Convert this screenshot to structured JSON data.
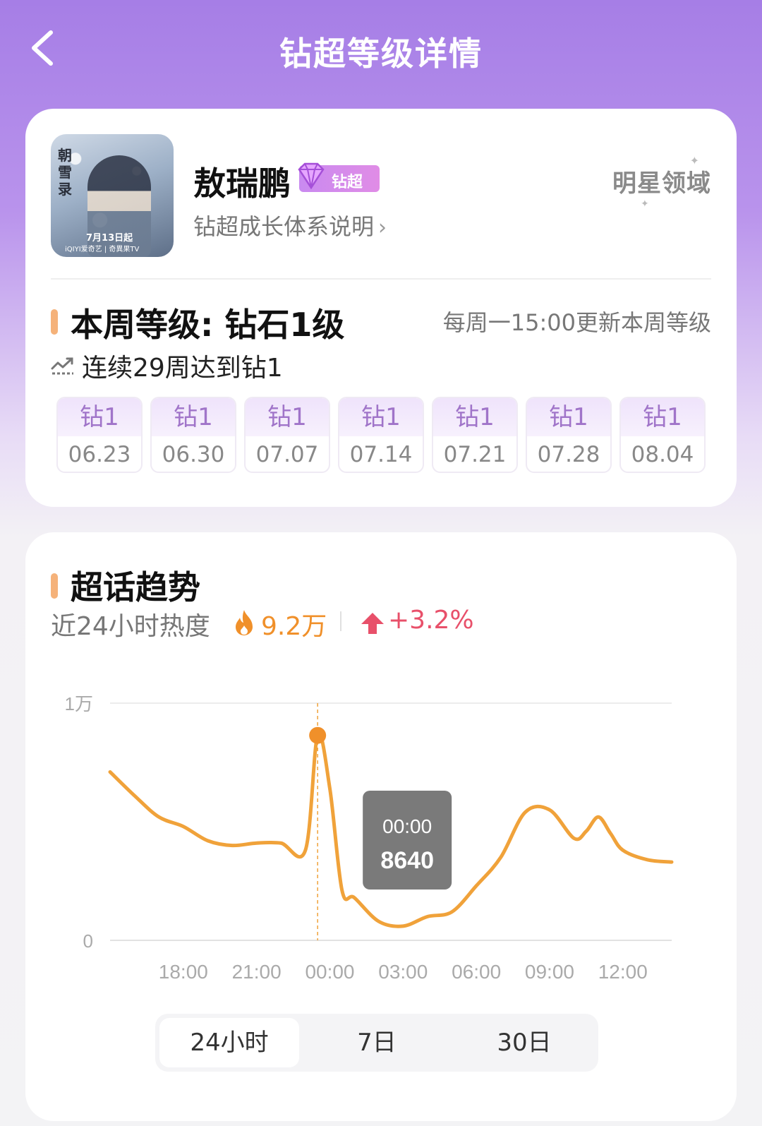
{
  "header": {
    "title": "钻超等级详情"
  },
  "profile": {
    "name": "敖瑞鹏",
    "badge_label": "钻超",
    "growth_link": "钻超成长体系说明",
    "domain_logo": "明星领域",
    "avatar_title": "朝雪录",
    "avatar_date": "7月13日起",
    "avatar_logos": "iQIYI爱奇艺 | 奇異果TV"
  },
  "level": {
    "title": "本周等级: 钻石1级",
    "update_note": "每周一15:00更新本周等级",
    "streak": "连续29周达到钻1",
    "weeks": [
      {
        "level": "钻1",
        "date": "06.23"
      },
      {
        "level": "钻1",
        "date": "06.30"
      },
      {
        "level": "钻1",
        "date": "07.07"
      },
      {
        "level": "钻1",
        "date": "07.14"
      },
      {
        "level": "钻1",
        "date": "07.21"
      },
      {
        "level": "钻1",
        "date": "07.28"
      },
      {
        "level": "钻1",
        "date": "08.04"
      }
    ]
  },
  "trend": {
    "title": "超话趋势",
    "heat_label": "近24小时热度",
    "heat_value": "9.2万",
    "change": "+3.2%",
    "tooltip": {
      "time": "00:00",
      "value": "8640"
    },
    "tabs": [
      {
        "label": "24小时",
        "active": true
      },
      {
        "label": "7日",
        "active": false
      },
      {
        "label": "30日",
        "active": false
      }
    ]
  },
  "colors": {
    "accent_orange": "#f0902a",
    "up_red": "#e8506a",
    "header_purple": "#a67ee6"
  },
  "chart_data": {
    "type": "line",
    "ylim": [
      0,
      10000
    ],
    "y_ticks": [
      "0",
      "1万"
    ],
    "x_ticks": [
      "18:00",
      "21:00",
      "00:00",
      "03:00",
      "06:00",
      "09:00",
      "12:00"
    ],
    "series": [
      {
        "hours_from_1500": [
          0,
          1,
          2,
          3,
          4,
          5,
          6,
          7,
          8,
          8.5,
          9,
          9.5,
          10,
          11,
          12,
          13,
          14,
          15,
          16,
          17,
          18,
          19,
          19.5,
          20,
          20.5,
          21,
          22,
          23
        ],
        "values": [
          7100,
          6100,
          5200,
          4800,
          4200,
          4000,
          4100,
          4100,
          3800,
          8640,
          6400,
          2100,
          1800,
          800,
          600,
          1000,
          1200,
          2300,
          3500,
          5400,
          5500,
          4300,
          4600,
          5200,
          4500,
          3800,
          3400,
          3300
        ]
      }
    ]
  }
}
